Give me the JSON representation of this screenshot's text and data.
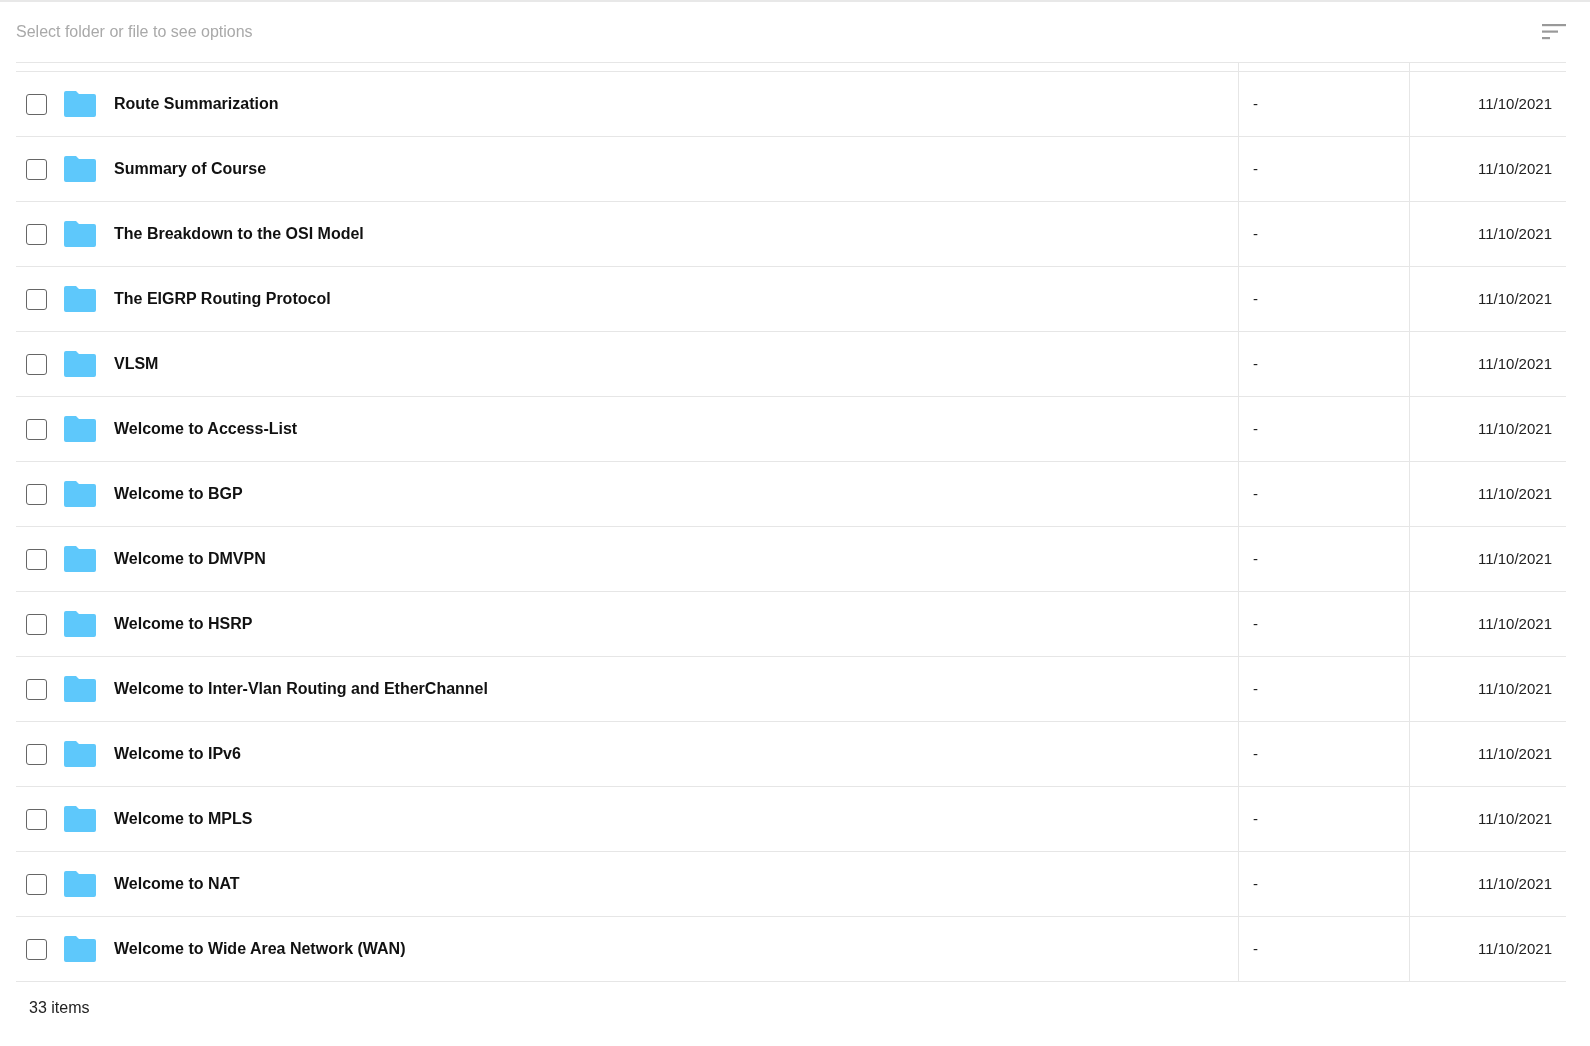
{
  "toolbar": {
    "hint": "Select folder or file to see options"
  },
  "rows": [
    {
      "name": "Route Summarization",
      "checked": false,
      "size": "-",
      "date": "11/10/2021"
    },
    {
      "name": "Summary of Course",
      "checked": false,
      "size": "-",
      "date": "11/10/2021"
    },
    {
      "name": "The Breakdown to the OSI Model",
      "checked": false,
      "size": "-",
      "date": "11/10/2021"
    },
    {
      "name": "The EIGRP Routing Protocol",
      "checked": false,
      "size": "-",
      "date": "11/10/2021"
    },
    {
      "name": "VLSM",
      "checked": false,
      "size": "-",
      "date": "11/10/2021"
    },
    {
      "name": "Welcome to Access-List",
      "checked": false,
      "size": "-",
      "date": "11/10/2021"
    },
    {
      "name": "Welcome to BGP",
      "checked": false,
      "size": "-",
      "date": "11/10/2021"
    },
    {
      "name": "Welcome to DMVPN",
      "checked": false,
      "size": "-",
      "date": "11/10/2021"
    },
    {
      "name": "Welcome to HSRP",
      "checked": false,
      "size": "-",
      "date": "11/10/2021"
    },
    {
      "name": "Welcome to Inter-Vlan Routing and EtherChannel",
      "checked": false,
      "size": "-",
      "date": "11/10/2021"
    },
    {
      "name": "Welcome to IPv6",
      "checked": false,
      "size": "-",
      "date": "11/10/2021"
    },
    {
      "name": "Welcome to MPLS",
      "checked": false,
      "size": "-",
      "date": "11/10/2021"
    },
    {
      "name": "Welcome to NAT",
      "checked": false,
      "size": "-",
      "date": "11/10/2021"
    },
    {
      "name": "Welcome to Wide Area Network (WAN)",
      "checked": false,
      "size": "-",
      "date": "11/10/2021"
    }
  ],
  "footer": {
    "count": "33 items"
  }
}
